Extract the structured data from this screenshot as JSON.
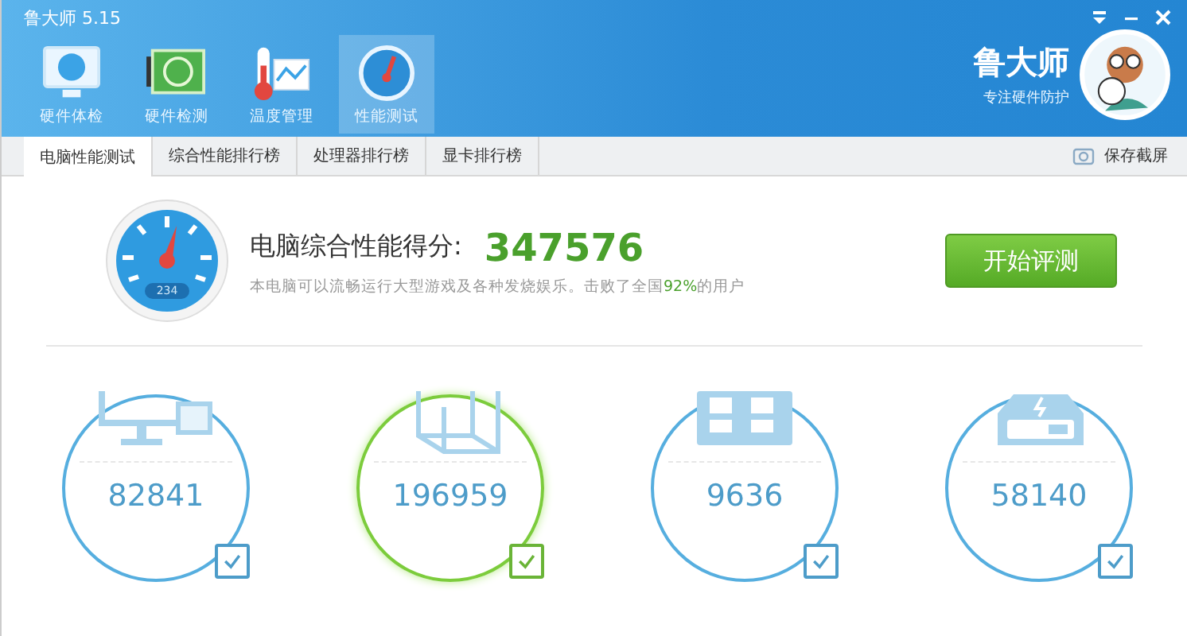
{
  "window": {
    "title": "鲁大师 5.15"
  },
  "nav": [
    {
      "label": "硬件体检",
      "kind": "monitor",
      "selected": false
    },
    {
      "label": "硬件检测",
      "kind": "board",
      "selected": false
    },
    {
      "label": "温度管理",
      "kind": "thermo",
      "selected": false
    },
    {
      "label": "性能测试",
      "kind": "gauge",
      "selected": true
    }
  ],
  "brand": {
    "name": "鲁大师",
    "slogan": "专注硬件防护"
  },
  "tabs": [
    {
      "label": "电脑性能测试",
      "selected": true
    },
    {
      "label": "综合性能排行榜",
      "selected": false
    },
    {
      "label": "处理器排行榜",
      "selected": false
    },
    {
      "label": "显卡排行榜",
      "selected": false
    }
  ],
  "screenshot_button": "保存截屏",
  "score": {
    "label": "电脑综合性能得分:",
    "value": "347576",
    "gauge_reading": "234",
    "description": "本电脑可以流畅运行大型游戏及各种发烧娱乐。击败了全国**92%**的用户"
  },
  "start_button": "开始评测",
  "components": [
    {
      "kind": "cpu",
      "score": "82841",
      "selected": false,
      "checked": true
    },
    {
      "kind": "gpu",
      "score": "196959",
      "selected": true,
      "checked": true
    },
    {
      "kind": "memory",
      "score": "9636",
      "selected": false,
      "checked": true
    },
    {
      "kind": "disk",
      "score": "58140",
      "selected": false,
      "checked": true
    }
  ]
}
